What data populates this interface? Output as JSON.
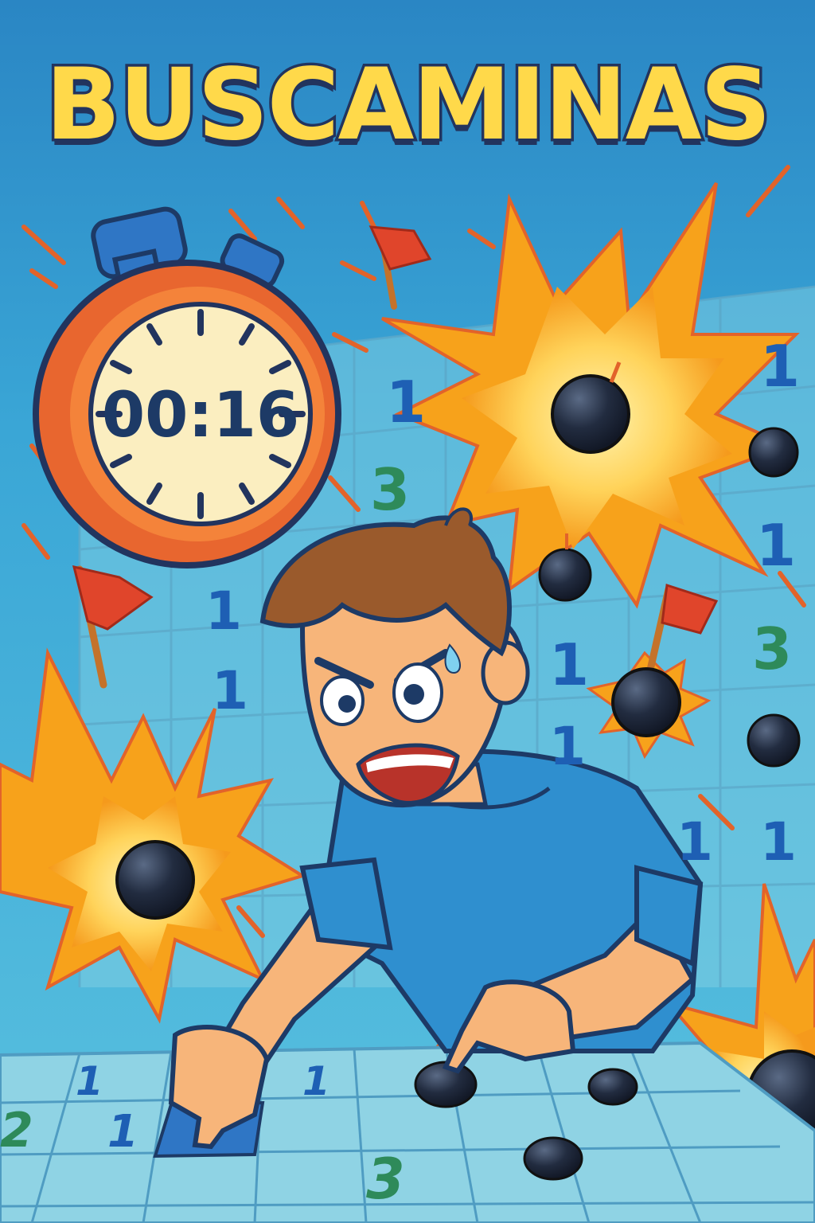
{
  "title": "BUSCAMINAS",
  "timer": {
    "display": "00:16"
  },
  "background_grid": {
    "numbers": [
      {
        "text": "1",
        "color": "#1e5fb4"
      },
      {
        "text": "3",
        "color": "#2e8a5a"
      },
      {
        "text": "1",
        "color": "#1e5fb4"
      },
      {
        "text": "1",
        "color": "#1e5fb4"
      },
      {
        "text": "1",
        "color": "#1e5fb4"
      },
      {
        "text": "1",
        "color": "#1e5fb4"
      },
      {
        "text": "1",
        "color": "#1e5fb4"
      },
      {
        "text": "3",
        "color": "#2e8a5a"
      },
      {
        "text": "1",
        "color": "#1e5fb4"
      },
      {
        "text": "1",
        "color": "#1e5fb4"
      },
      {
        "text": "1",
        "color": "#1e5fb4"
      }
    ]
  },
  "board": {
    "numbers": [
      {
        "text": "1",
        "color": "#1e5fb4"
      },
      {
        "text": "1",
        "color": "#1e5fb4"
      },
      {
        "text": "2",
        "color": "#2e8a5a"
      },
      {
        "text": "1",
        "color": "#1e5fb4"
      },
      {
        "text": "3",
        "color": "#2e8a5a"
      }
    ]
  },
  "colors": {
    "title_fill": "#ffd94a",
    "outline": "#22345e",
    "explosion_outer": "#f7a21b",
    "explosion_inner": "#ffe07a",
    "flag": "#e0452b",
    "mine": "#1f2a3d",
    "shirt": "#2f8fcf",
    "skin": "#f7b57a",
    "hair": "#9a5a2c"
  },
  "icons": [
    "stopwatch-icon",
    "flag-icon",
    "mine-icon",
    "explosion-icon"
  ]
}
